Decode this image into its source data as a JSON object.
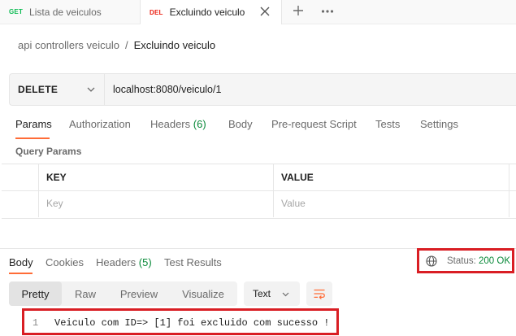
{
  "tabs": [
    {
      "method": "GET",
      "label": "Lista de veiculos"
    },
    {
      "method": "DEL",
      "label": "Excluindo veiculo"
    }
  ],
  "breadcrumb": {
    "parent": "api controllers veiculo",
    "separator": "/",
    "current": "Excluindo veiculo"
  },
  "request": {
    "method": "DELETE",
    "url": "localhost:8080/veiculo/1"
  },
  "request_tabs": {
    "params": "Params",
    "authorization": "Authorization",
    "headers": "Headers",
    "headers_count": "(6)",
    "body": "Body",
    "prerequest": "Pre-request Script",
    "tests": "Tests",
    "settings": "Settings"
  },
  "query_params": {
    "title": "Query Params",
    "key_header": "KEY",
    "value_header": "VALUE",
    "key_placeholder": "Key",
    "value_placeholder": "Value"
  },
  "response_tabs": {
    "body": "Body",
    "cookies": "Cookies",
    "headers": "Headers",
    "headers_count": "(5)",
    "test_results": "Test Results"
  },
  "status": {
    "label": "Status:",
    "value": "200 OK"
  },
  "format": {
    "pretty": "Pretty",
    "raw": "Raw",
    "preview": "Preview",
    "visualize": "Visualize",
    "type": "Text"
  },
  "response_body": {
    "line_number": "1",
    "text": "Veiculo com ID=> [1] foi excluido com sucesso !"
  },
  "colors": {
    "accent": "#ff6c37",
    "highlight_border": "#d91e24",
    "get": "#0cbb52",
    "delete": "#eb2013",
    "status_ok": "#0a8a3a"
  },
  "icons": [
    "close-icon",
    "plus-icon",
    "more-icon",
    "chevron-down-icon",
    "globe-icon",
    "wrap-lines-icon"
  ]
}
